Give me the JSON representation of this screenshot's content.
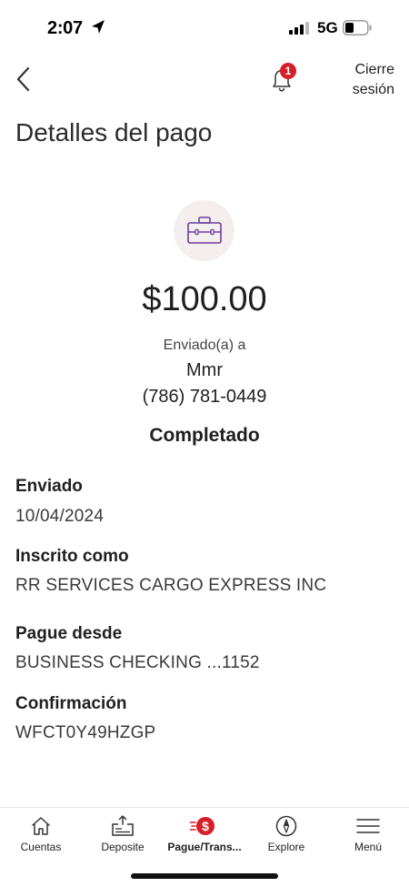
{
  "status_bar": {
    "time": "2:07",
    "network": "5G"
  },
  "header": {
    "notification_count": "1",
    "logout_label_line1": "Cierre",
    "logout_label_line2": "sesión"
  },
  "page_title": "Detalles del pago",
  "summary": {
    "amount": "$100.00",
    "sent_to_label": "Enviado(a) a",
    "recipient_name": "Mmr",
    "recipient_phone": "(786) 781-0449",
    "status": "Completado"
  },
  "details": [
    {
      "label": "Enviado",
      "value": "10/04/2024"
    },
    {
      "label": "Inscrito como",
      "value": "RR SERVICES CARGO EXPRESS INC"
    },
    {
      "label": "Pague desde",
      "value": "BUSINESS CHECKING ...1152"
    },
    {
      "label": "Confirmación",
      "value": "WFCT0Y49HZGP"
    }
  ],
  "tab_bar": [
    {
      "label": "Cuentas",
      "icon": "home-icon",
      "active": false
    },
    {
      "label": "Deposite",
      "icon": "deposit-check-icon",
      "active": false
    },
    {
      "label": "Pague/Trans...",
      "icon": "pay-transfer-icon",
      "active": true
    },
    {
      "label": "Explore",
      "icon": "compass-icon",
      "active": false
    },
    {
      "label": "Menú",
      "icon": "menu-icon",
      "active": false
    }
  ],
  "colors": {
    "brand_red": "#d71e28",
    "accent_purple": "#6b3fa0",
    "icon_bg": "#f4efee"
  }
}
